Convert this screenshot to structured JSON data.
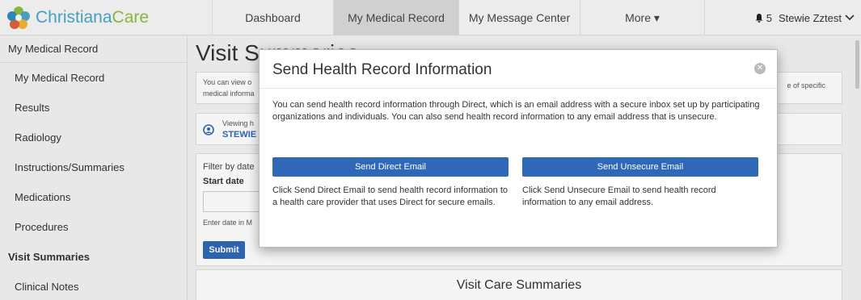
{
  "brand": {
    "name_part1": "Christiana",
    "name_part2": "Care"
  },
  "nav": {
    "tabs": [
      {
        "label": "Dashboard"
      },
      {
        "label": "My Medical Record"
      },
      {
        "label": "My Message Center"
      },
      {
        "label": "More ▾"
      }
    ],
    "notification_count": "5",
    "user_name": "Stewie Zztest"
  },
  "sidebar": {
    "header": "My Medical Record",
    "items": [
      {
        "label": "My Medical Record"
      },
      {
        "label": "Results"
      },
      {
        "label": "Radiology"
      },
      {
        "label": "Instructions/Summaries"
      },
      {
        "label": "Medications"
      },
      {
        "label": "Procedures"
      },
      {
        "label": "Visit Summaries"
      },
      {
        "label": "Clinical Notes"
      }
    ]
  },
  "main": {
    "title": "Visit Summaries",
    "info_left": "You can view o",
    "info_left2": "medical informa",
    "info_right": "e of specific",
    "viewing_label": "Viewing h",
    "viewing_name": "STEWIE",
    "filter_label": "Filter by date",
    "start_date_label": "Start date",
    "date_hint": "Enter date in M",
    "submit_label": "Submit",
    "care_summaries_heading": "Visit Care Summaries"
  },
  "modal": {
    "title": "Send Health Record Information",
    "description": "You can send health record information through Direct, which is an email address with a secure inbox set up by participating organizations and individuals. You can also send health record information to any email address that is unsecure.",
    "direct_button": "Send Direct Email",
    "unsecure_button": "Send Unsecure Email",
    "direct_note": "Click Send Direct Email to send health record information to a health care provider that uses Direct for secure emails.",
    "unsecure_note": "Click Send Unsecure Email to send health record information to any email address."
  },
  "colors": {
    "primary_button": "#3068b8",
    "brand_blue": "#4aa6c8",
    "brand_green": "#8cbf3f"
  }
}
